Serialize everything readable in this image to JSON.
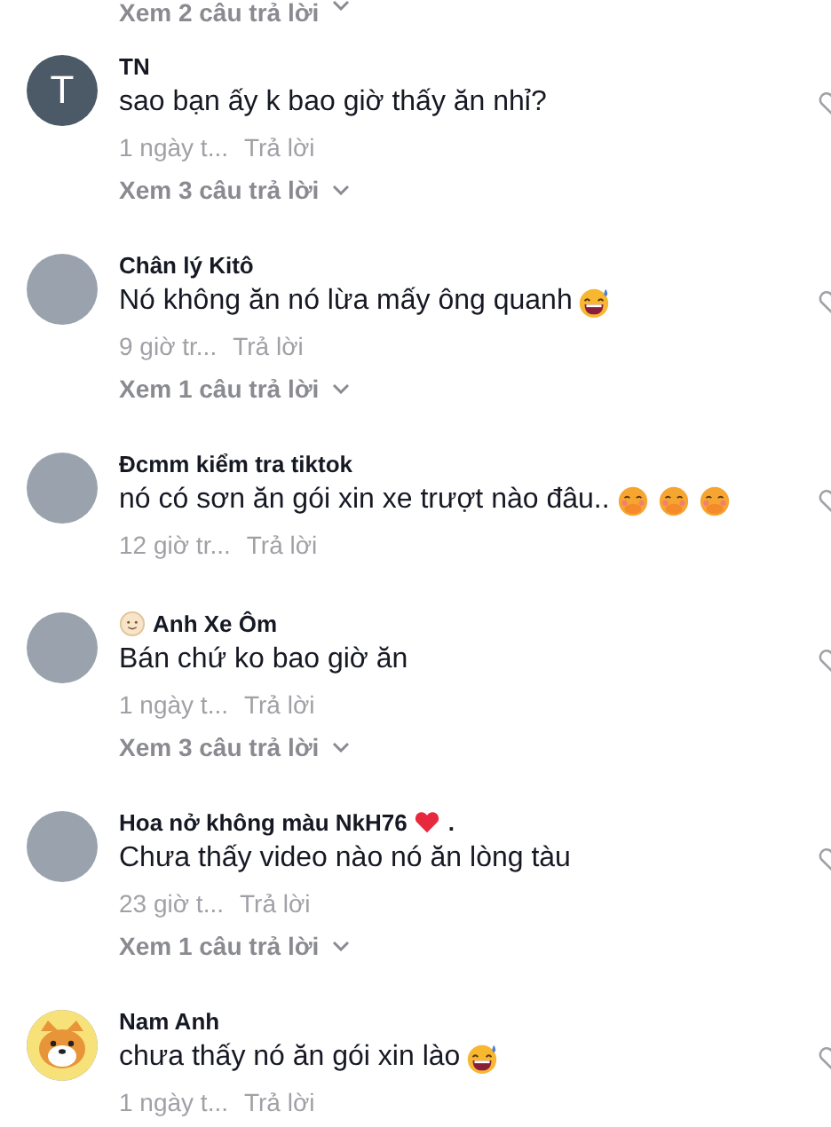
{
  "top_replies_link": "Xem 2 câu trả lời",
  "comments": [
    {
      "avatar": {
        "kind": "letter",
        "letter": "T"
      },
      "name": "TN",
      "text": "sao bạn ấy k bao giờ thấy ăn nhỉ?",
      "time": "1 ngày t...",
      "reply": "Trả lời",
      "view_replies": "Xem 3 câu trả lời"
    },
    {
      "avatar": {
        "kind": "photo"
      },
      "name": "Chân lý Kitô",
      "text": "Nó không ăn nó lừa mấy ông quanh",
      "emojis": [
        {
          "kind": "sweat-smile"
        }
      ],
      "time": "9 giờ tr...",
      "reply": "Trả lời",
      "view_replies": "Xem 1 câu trả lời"
    },
    {
      "avatar": {
        "kind": "photo"
      },
      "name": "Đcmm kiểm tra tiktok",
      "text": "nó có sơn ăn gói xin xe trượt nào đâu..",
      "emojis": [
        {
          "kind": "hand-over-mouth"
        },
        {
          "kind": "hand-over-mouth"
        },
        {
          "kind": "hand-over-mouth"
        }
      ],
      "time": "12 giờ tr...",
      "reply": "Trả lời"
    },
    {
      "avatar": {
        "kind": "photo"
      },
      "name_badge": {
        "kind": "smiley"
      },
      "name": "Anh Xe Ôm",
      "text": "Bán chứ ko bao giờ ăn",
      "time": "1 ngày t...",
      "reply": "Trả lời",
      "view_replies": "Xem 3 câu trả lời"
    },
    {
      "avatar": {
        "kind": "photo"
      },
      "name": "Hoa nở không màu NkH76",
      "name_suffix_icon": {
        "kind": "heart"
      },
      "name_suffix": ".",
      "text": "Chưa thấy video nào nó ăn lòng tàu",
      "time": "23 giờ t...",
      "reply": "Trả lời",
      "view_replies": "Xem 1 câu trả lời"
    },
    {
      "avatar": {
        "kind": "cartoon"
      },
      "name": "Nam Anh",
      "text": "chưa thấy nó ăn gói xin lào",
      "emojis": [
        {
          "kind": "sweat-smile"
        }
      ],
      "time": "1 ngày t...",
      "reply": "Trả lời"
    }
  ]
}
